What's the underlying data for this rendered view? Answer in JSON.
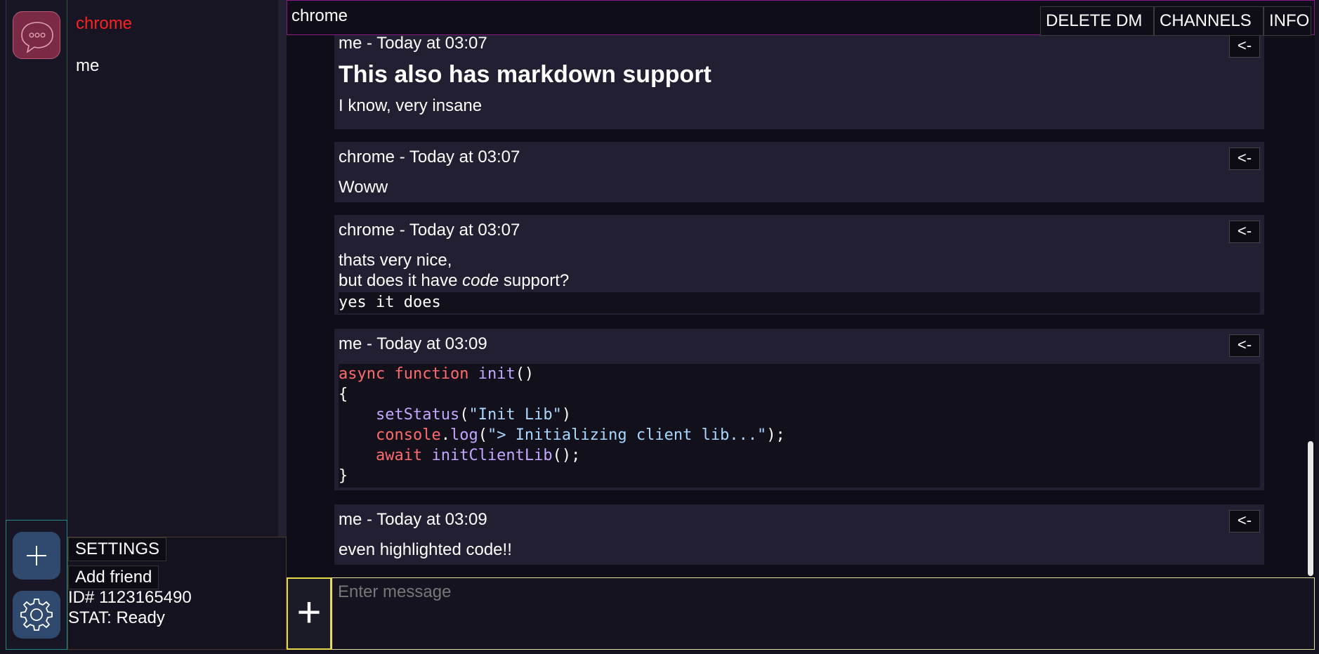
{
  "dm_list": {
    "items": [
      "chrome",
      "me"
    ]
  },
  "user_panel": {
    "settings_label": "SETTINGS",
    "add_friend_label": "Add friend",
    "id_text": "ID# 1123165490",
    "status_text": "STAT: Ready"
  },
  "header": {
    "title": "chrome",
    "delete_dm_label": "DELETE DM",
    "channels_label": "CHANNELS",
    "info_label": "INFO"
  },
  "reply_label": "<-",
  "messages": [
    {
      "head": "me - Today at 03:07",
      "heading": "This also has markdown support",
      "text": "I know, very insane"
    },
    {
      "head": "chrome - Today at 03:07",
      "text": "Woww"
    },
    {
      "head": "chrome - Today at 03:07",
      "line1": "thats very nice,",
      "line2_pre": "but does it have ",
      "line2_em": "code",
      "line2_post": " support?",
      "code": "yes it does"
    },
    {
      "head": "me - Today at 03:09",
      "code_lines": {
        "l1_kw1": "async",
        "l1_kw2": "function",
        "l1_fn": "init",
        "l1_rest": "()",
        "l2": "{",
        "l3_fn": "setStatus",
        "l3_p1": "(",
        "l3_str": "\"Init Lib\"",
        "l3_p2": ")",
        "l4_obj": "console",
        "l4_dot": ".",
        "l4_fn": "log",
        "l4_p1": "(",
        "l4_str": "\"> Initializing client lib...\"",
        "l4_p2": ");",
        "l5_kw": "await",
        "l5_fn": "initClientLib",
        "l5_rest": "();",
        "l6": "}"
      }
    },
    {
      "head": "me - Today at 03:09",
      "text": "even highlighted code!!"
    }
  ],
  "composer": {
    "attach_label": "+",
    "placeholder": "Enter message"
  }
}
